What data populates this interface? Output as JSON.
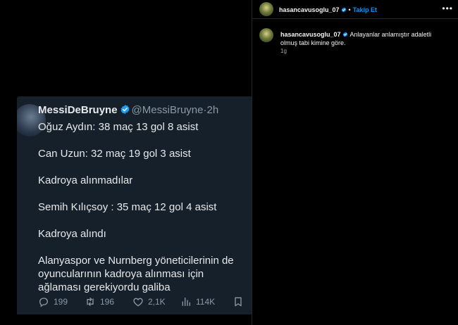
{
  "tweet": {
    "name": "MessiDeBruyne",
    "handle": "@MessiBruyne",
    "separator": "·",
    "time": "2h",
    "lines": [
      "Oğuz Aydın: 38 maç 13 gol 8 asist",
      "Can Uzun: 32 maç 19 gol 3 asist",
      "Kadroya alınmadılar",
      "Semih Kılıçsoy : 35 maç 12 gol 4 asist",
      "Kadroya alındı",
      "Alanyaspor ve Nurnberg yöneticilerinin de oyuncularının kadroya alınması için ağlaması gerekiyordu galiba"
    ],
    "stats": {
      "replies": "199",
      "retweets": "196",
      "likes": "2,1K",
      "views": "114K"
    },
    "colors": {
      "background": "#15202b",
      "verified": "#1d9bf0",
      "muted": "#8b98a5"
    }
  },
  "instagram": {
    "username": "hasancavusoglu_07",
    "dot": "•",
    "follow_label": "Takip Et",
    "more_icon": "more-horizontal-icon",
    "caption_username": "hasancavusoglu_07",
    "caption": "Anlayanlar anlamıştır adaletli olmuş tabi kimine göre.",
    "time": "1g",
    "colors": {
      "follow": "#0095f6",
      "verified": "#0095f6"
    }
  }
}
